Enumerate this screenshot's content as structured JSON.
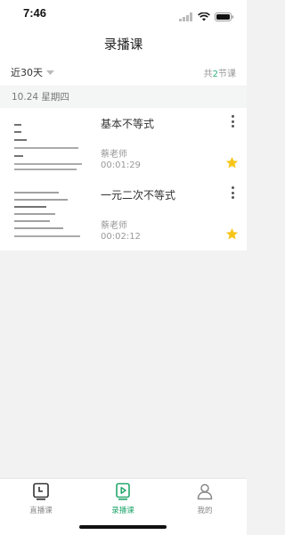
{
  "status_bar": {
    "time": "7:46"
  },
  "header": {
    "title": "录播课"
  },
  "filter": {
    "period_label": "近30天",
    "count_prefix": "共",
    "count_value": "2",
    "count_suffix": "节课"
  },
  "date_group": {
    "label": "10.24 星期四"
  },
  "lessons": [
    {
      "title": "基本不等式",
      "teacher": "蔡老师",
      "duration": "00:01:29",
      "favorited": true
    },
    {
      "title": "一元二次不等式",
      "teacher": "蔡老师",
      "duration": "00:02:12",
      "favorited": true
    }
  ],
  "tabs": [
    {
      "label": "直播课",
      "active": false
    },
    {
      "label": "录播课",
      "active": true
    },
    {
      "label": "我的",
      "active": false
    }
  ],
  "colors": {
    "accent": "#23a76d",
    "star": "#f7c51a"
  }
}
